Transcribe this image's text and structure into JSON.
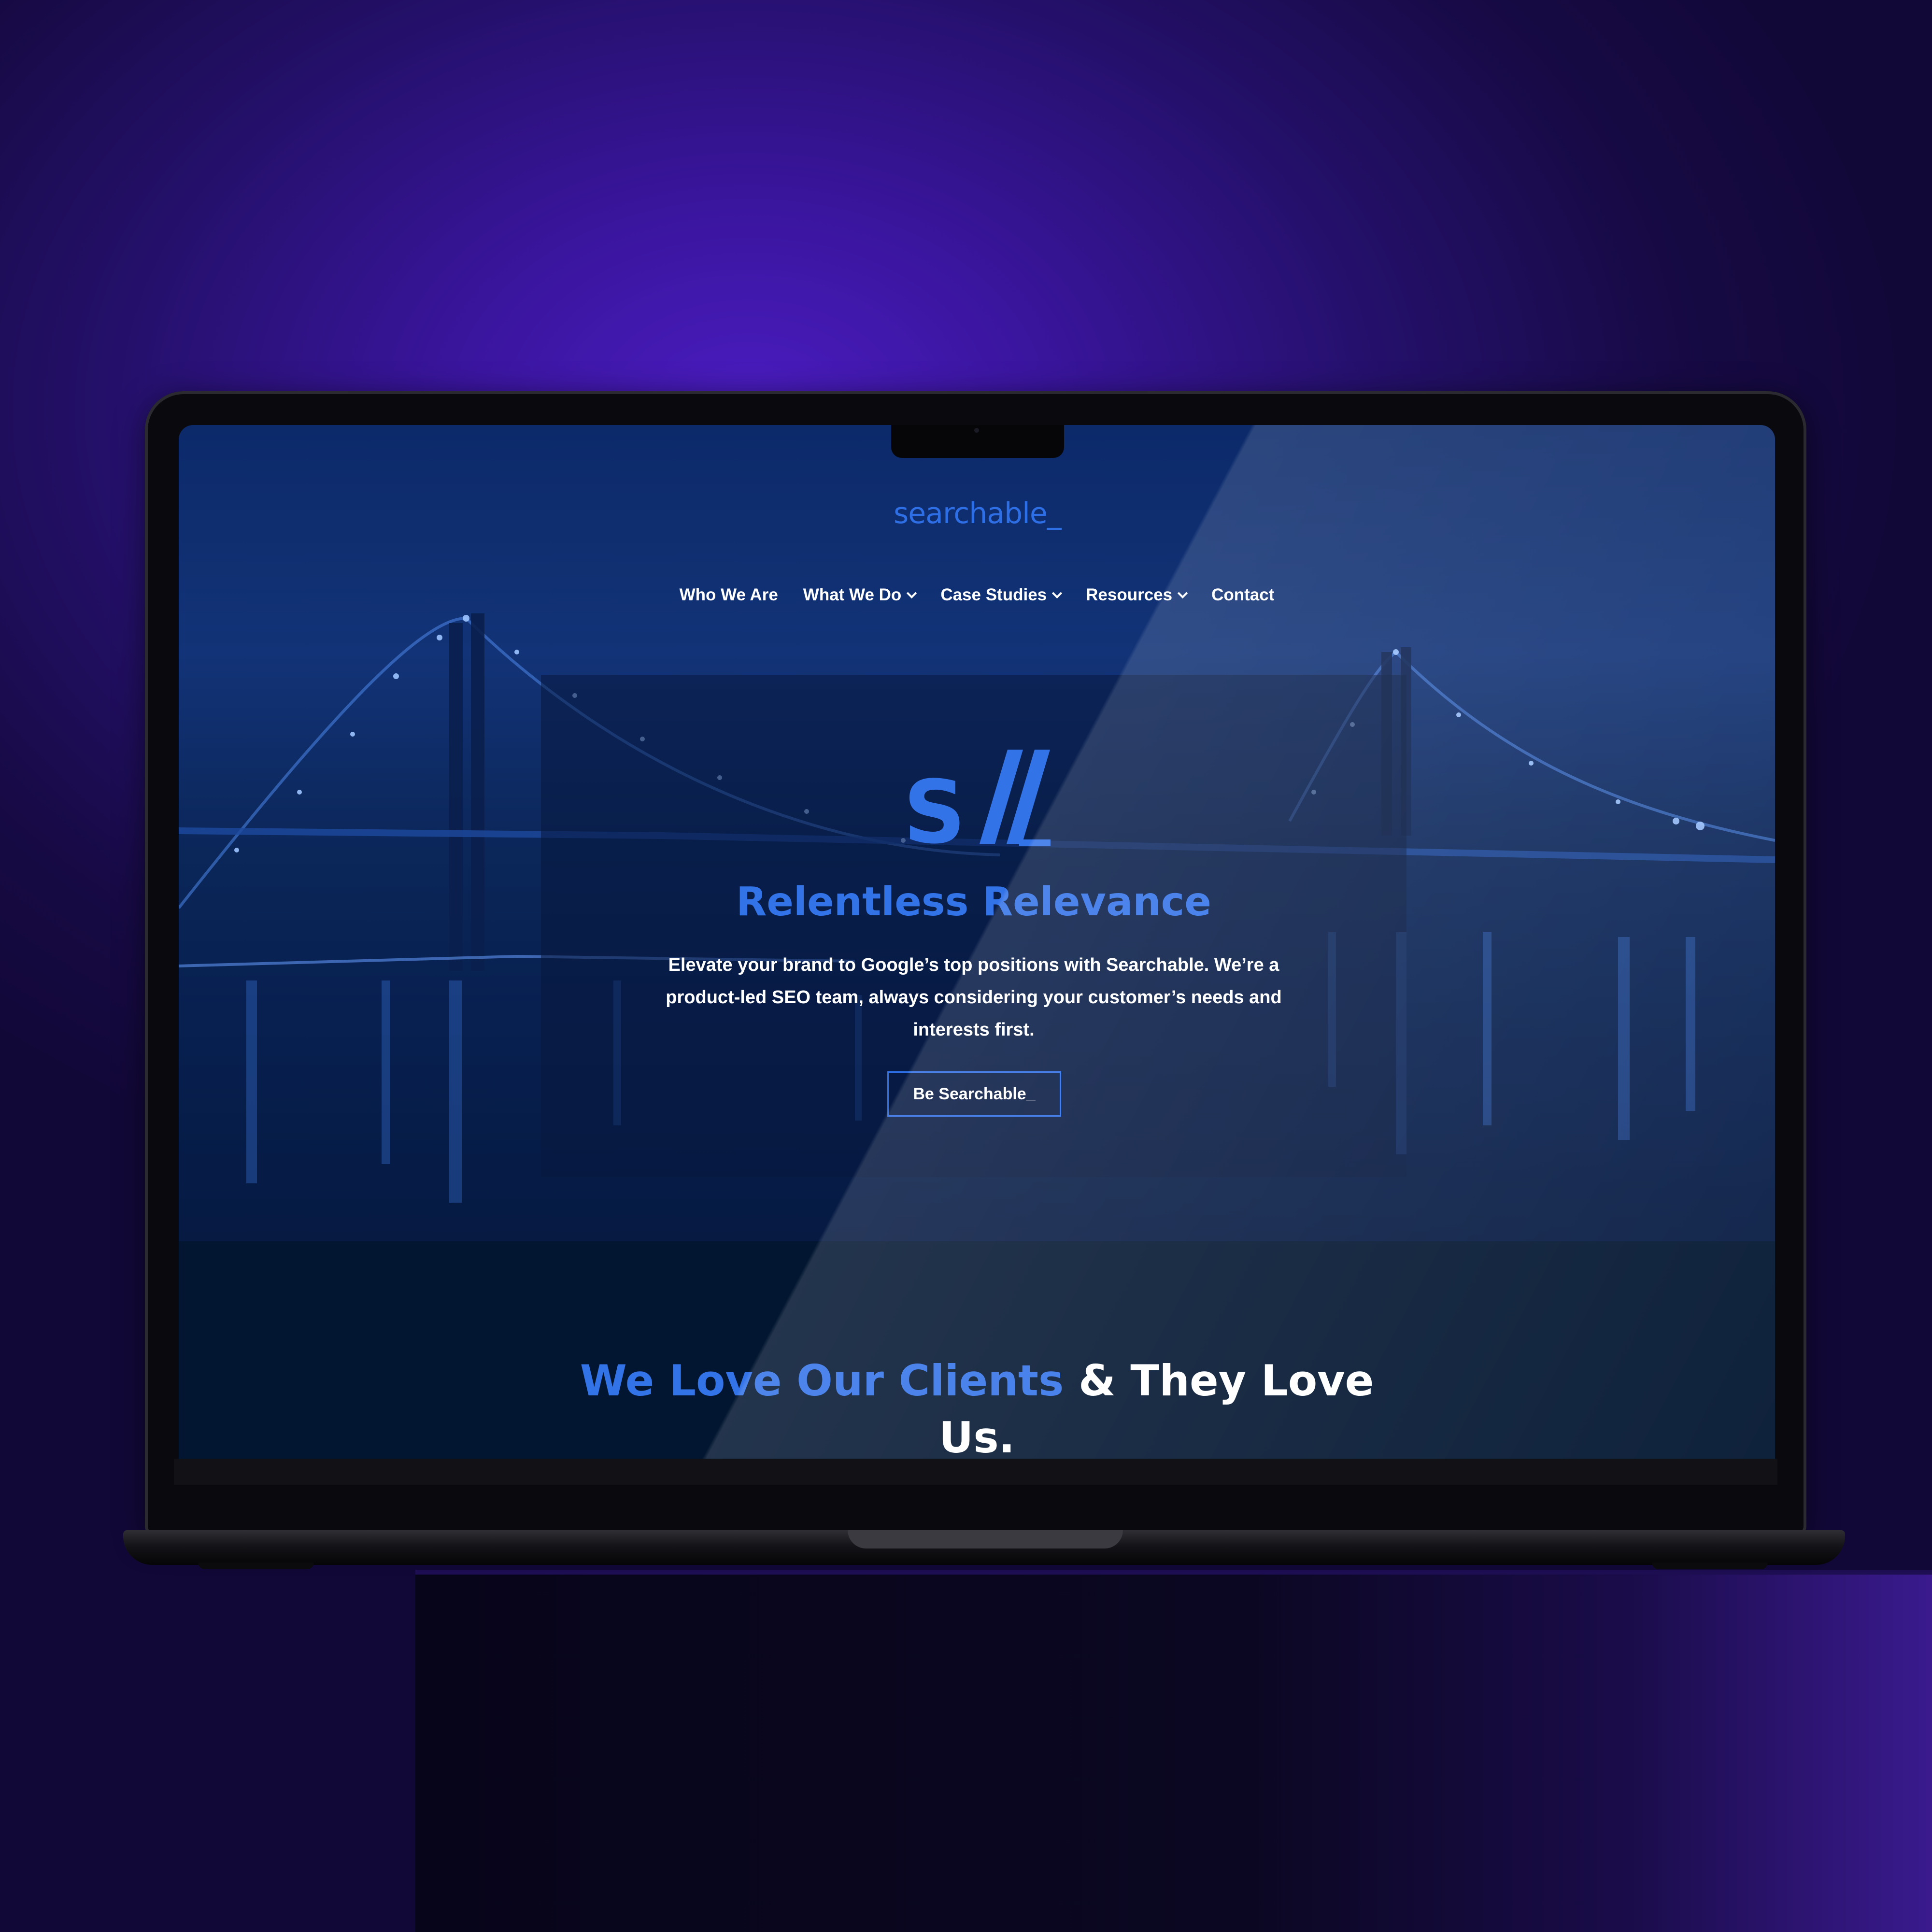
{
  "site": {
    "logo_text": "searchable_",
    "nav": [
      {
        "label": "Who We Are",
        "has_dropdown": false
      },
      {
        "label": "What We Do",
        "has_dropdown": true
      },
      {
        "label": "Case Studies",
        "has_dropdown": true
      },
      {
        "label": "Resources",
        "has_dropdown": true
      },
      {
        "label": "Contact",
        "has_dropdown": false
      }
    ],
    "hero": {
      "monogram": "S//_",
      "headline": "Relentless Relevance",
      "lede": "Elevate your brand to Google’s top positions with Searchable. We’re a product-led SEO team, always considering your customer’s needs and interests first.",
      "cta_label": "Be Searchable_"
    },
    "section": {
      "title_highlight": "We Love Our Clients",
      "title_rest": " & They Love Us."
    }
  },
  "colors": {
    "accent_blue": "#3373e8",
    "background_purple": "#3a159e",
    "site_background": "#021631"
  },
  "icons": [
    "chevron-down-icon"
  ]
}
